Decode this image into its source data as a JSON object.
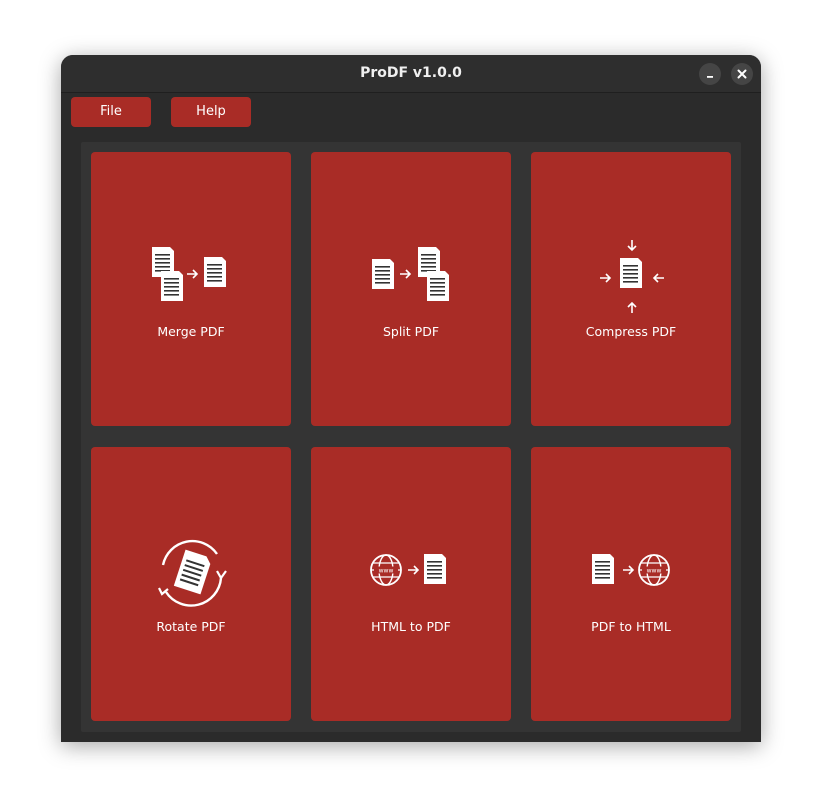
{
  "window": {
    "title": "ProDF v1.0.0"
  },
  "menu": {
    "file_label": "File",
    "help_label": "Help"
  },
  "tools": [
    {
      "label": "Merge PDF",
      "icon": "merge-icon"
    },
    {
      "label": "Split PDF",
      "icon": "split-icon"
    },
    {
      "label": "Compress PDF",
      "icon": "compress-icon"
    },
    {
      "label": "Rotate PDF",
      "icon": "rotate-icon"
    },
    {
      "label": "HTML to PDF",
      "icon": "html-to-pdf-icon"
    },
    {
      "label": "PDF to HTML",
      "icon": "pdf-to-html-icon"
    }
  ],
  "colors": {
    "accent": "#a92c26",
    "window_bg": "#2b2b2b",
    "panel_bg": "#343434"
  }
}
